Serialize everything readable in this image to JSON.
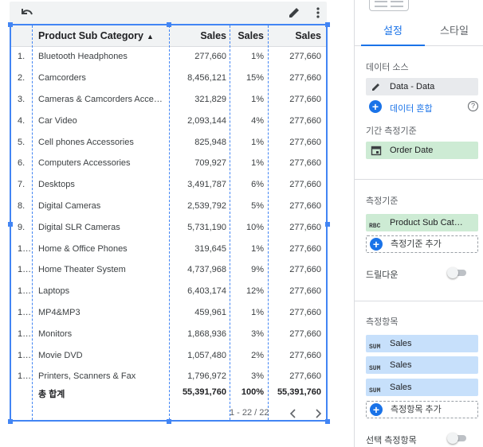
{
  "table": {
    "columns": [
      {
        "key": "idx",
        "label": ""
      },
      {
        "key": "category",
        "label": "Product Sub Category",
        "sort": "▲"
      },
      {
        "key": "sales",
        "label": "Sales"
      },
      {
        "key": "sales_pct",
        "label": "Sales"
      },
      {
        "key": "sales_2",
        "label": "Sales"
      }
    ],
    "rows": [
      {
        "idx": "1.",
        "category": "Bluetooth Headphones",
        "sales": "277,660",
        "pct": "1%",
        "sales2": "277,660"
      },
      {
        "idx": "2.",
        "category": "Camcorders",
        "sales": "8,456,121",
        "pct": "15%",
        "sales2": "277,660"
      },
      {
        "idx": "3.",
        "category": "Cameras & Camcorders Acces…",
        "sales": "321,829",
        "pct": "1%",
        "sales2": "277,660"
      },
      {
        "idx": "4.",
        "category": "Car Video",
        "sales": "2,093,144",
        "pct": "4%",
        "sales2": "277,660"
      },
      {
        "idx": "5.",
        "category": "Cell phones Accessories",
        "sales": "825,948",
        "pct": "1%",
        "sales2": "277,660"
      },
      {
        "idx": "6.",
        "category": "Computers Accessories",
        "sales": "709,927",
        "pct": "1%",
        "sales2": "277,660"
      },
      {
        "idx": "7.",
        "category": "Desktops",
        "sales": "3,491,787",
        "pct": "6%",
        "sales2": "277,660"
      },
      {
        "idx": "8.",
        "category": "Digital Cameras",
        "sales": "2,539,792",
        "pct": "5%",
        "sales2": "277,660"
      },
      {
        "idx": "9.",
        "category": "Digital SLR Cameras",
        "sales": "5,731,190",
        "pct": "10%",
        "sales2": "277,660"
      },
      {
        "idx": "1…",
        "category": "Home & Office Phones",
        "sales": "319,645",
        "pct": "1%",
        "sales2": "277,660"
      },
      {
        "idx": "1…",
        "category": "Home Theater System",
        "sales": "4,737,968",
        "pct": "9%",
        "sales2": "277,660"
      },
      {
        "idx": "1…",
        "category": "Laptops",
        "sales": "6,403,174",
        "pct": "12%",
        "sales2": "277,660"
      },
      {
        "idx": "1…",
        "category": "MP4&MP3",
        "sales": "459,961",
        "pct": "1%",
        "sales2": "277,660"
      },
      {
        "idx": "1…",
        "category": "Monitors",
        "sales": "1,868,936",
        "pct": "3%",
        "sales2": "277,660"
      },
      {
        "idx": "1…",
        "category": "Movie DVD",
        "sales": "1,057,480",
        "pct": "2%",
        "sales2": "277,660"
      },
      {
        "idx": "1…",
        "category": "Printers, Scanners & Fax",
        "sales": "1,796,972",
        "pct": "3%",
        "sales2": "277,660"
      }
    ],
    "total": {
      "label": "총 합계",
      "sales": "55,391,760",
      "pct": "100%",
      "sales2": "55,391,760"
    },
    "pager": {
      "range": "1 - 22 / 22"
    }
  },
  "icons": {
    "undo": "undo-icon",
    "edit": "pencil-icon",
    "more": "more-vert-icon",
    "prev": "chevron-left-icon",
    "next": "chevron-right-icon"
  },
  "panel": {
    "tabs": {
      "setup": "설정",
      "style": "스타일"
    },
    "data_source_label": "데이터 소스",
    "data_source": "Data - Data",
    "blend_link": "데이터 혼합",
    "date_range_label": "기간 측정기준",
    "date_range_dim": "Order Date",
    "dimension_label": "측정기준",
    "dimension_badge": "RBC",
    "dimension": "Product Sub Cat…",
    "add_dimension": "측정기준 추가",
    "drilldown_label": "드릴다운",
    "metric_label": "측정항목",
    "metric_badge": "SUM",
    "metrics": [
      "Sales",
      "Sales",
      "Sales"
    ],
    "add_metric": "측정항목 추가",
    "optional_metric_label": "선택 측정항목"
  },
  "colors": {
    "accent": "#1a73e8",
    "selection": "#4285f4",
    "chip_dimension": "#cdebd4",
    "chip_metric": "#c7e0fb",
    "chip_source": "#e8eaed"
  }
}
